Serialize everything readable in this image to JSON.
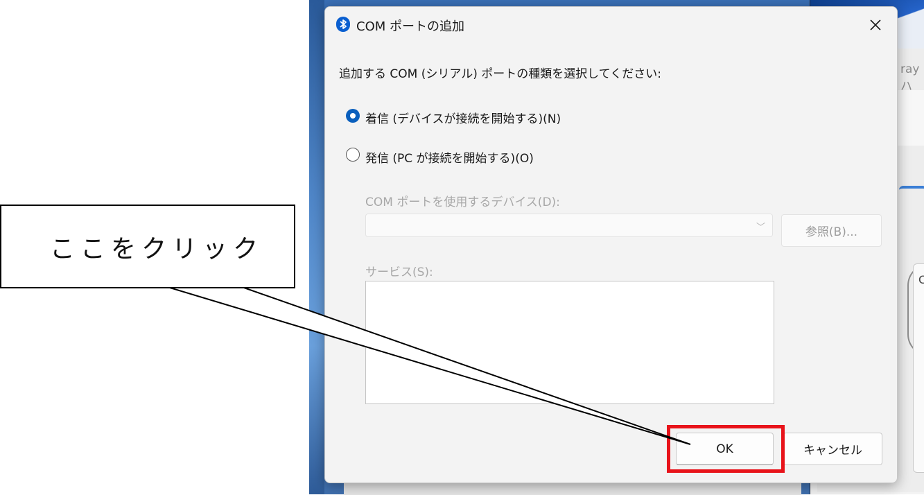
{
  "dialog": {
    "title": "COM ポートの追加",
    "prompt": "追加する COM (シリアル) ポートの種類を選択してください:",
    "options": {
      "incoming": {
        "label": "着信 (デバイスが接続を開始する)(N)",
        "selected": true
      },
      "outgoing": {
        "label": "発信 (PC が接続を開始する)(O)",
        "selected": false
      }
    },
    "device_label": "COM ポートを使用するデバイス(D):",
    "device_value": "",
    "browse_label": "参照(B)...",
    "service_label": "サービス(S):",
    "ok_label": "OK",
    "cancel_label": "キャンセル"
  },
  "background": {
    "window_title_fragment": "ray ハ",
    "card_letter": "C"
  },
  "annotation": {
    "callout_text": "ここをクリック",
    "highlight_color": "#e8131a"
  },
  "colors": {
    "accent": "#0a5fbd",
    "dialog_bg": "#f3f3f3"
  },
  "icons": {
    "title": "bluetooth-icon",
    "close": "close-icon",
    "dropdown": "chevron-down-icon"
  }
}
